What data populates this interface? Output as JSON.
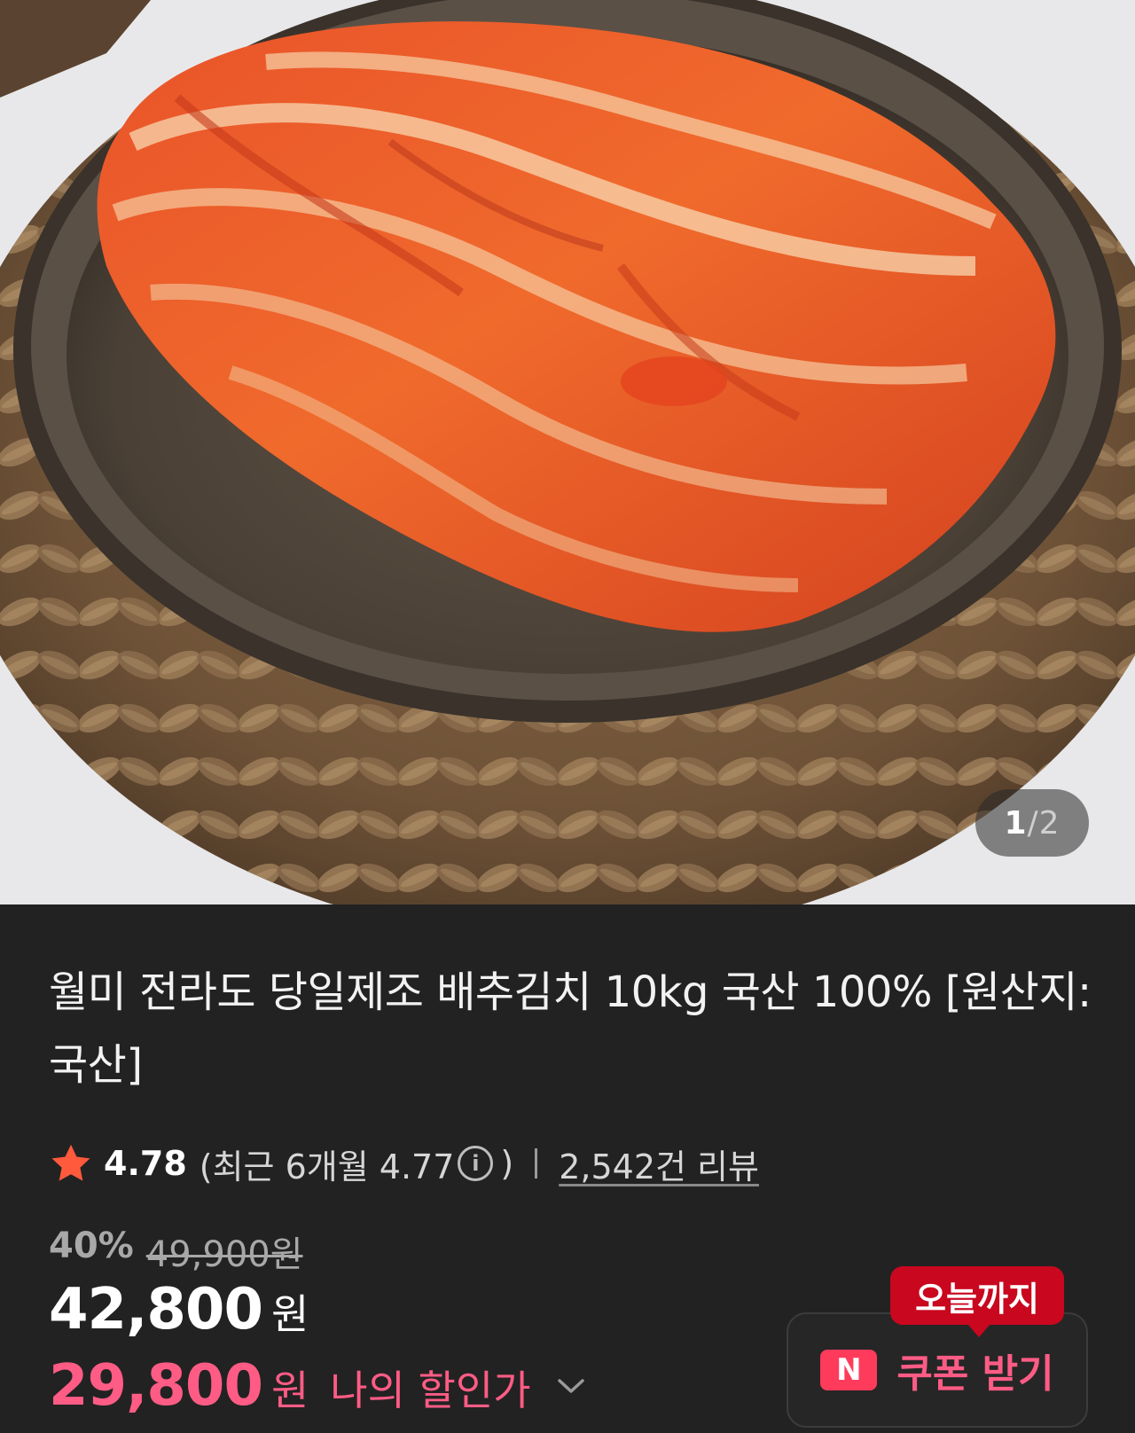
{
  "gallery": {
    "current_page": "1",
    "separator": "/",
    "total_pages": "2",
    "image_icon": "kimchi-photo"
  },
  "product": {
    "title": "월미 전라도 당일제조 배추김치 10kg 국산 100% [원산지:국산]"
  },
  "rating": {
    "star_icon": "star-icon",
    "score": "4.78",
    "recent_prefix": "(최근 6개월 4.77",
    "recent_suffix": ")",
    "info_icon_glyph": "i",
    "reviews": "2,542건 리뷰"
  },
  "pricing": {
    "discount_rate": "40%",
    "original_price": "49,900원",
    "price": "42,800",
    "price_unit": "원",
    "my_price": "29,800",
    "my_price_unit": "원",
    "my_price_label": "나의 할인가"
  },
  "coupon": {
    "badge": "오늘까지",
    "logo_letter": "N",
    "label": "쿠폰 받기"
  },
  "colors": {
    "background": "#222222",
    "accent_pink": "#ff5c85",
    "badge_red": "#c9071f",
    "star_orange": "#ff5a3c",
    "naver_red": "#ff3b5c"
  }
}
